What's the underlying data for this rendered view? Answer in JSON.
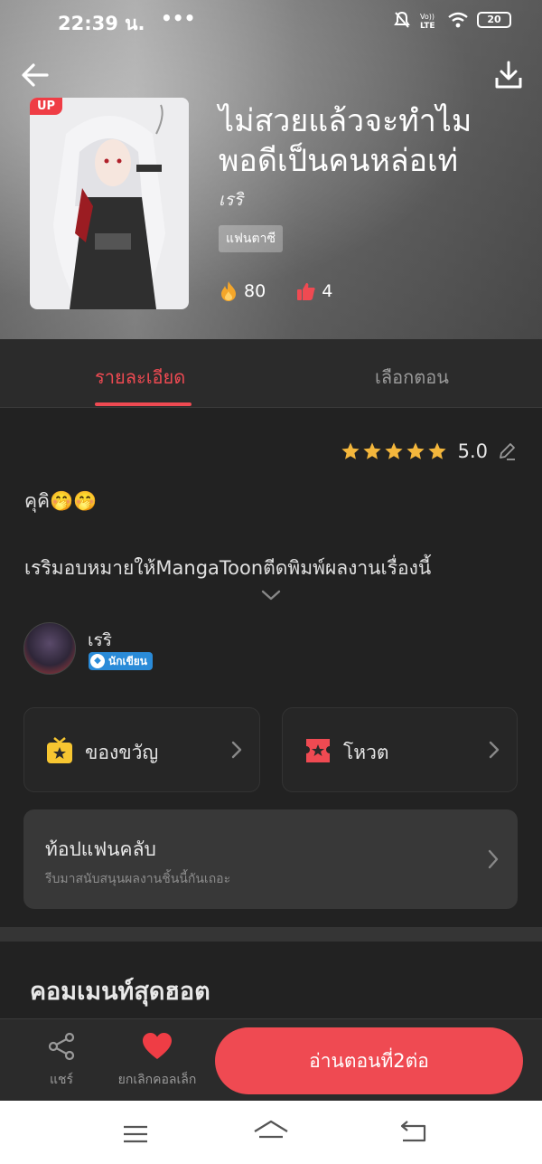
{
  "status_bar": {
    "time": "22:39 น.",
    "extra": "•••",
    "battery": "20"
  },
  "header": {
    "title_line1": "ไม่สวยแล้วจะทำไม",
    "title_line2": "พอดีเป็นคนหล่อเท่",
    "author": "เรริ",
    "genre": "แฟนตาซี",
    "cover_badge": "UP",
    "views": "80",
    "likes": "4"
  },
  "tabs": {
    "detail": "รายละเอียด",
    "episodes": "เลือกตอน"
  },
  "rating": {
    "value": "5.0",
    "stars": 5
  },
  "description": {
    "line1": "คุคิ🤭🤭",
    "line2": "เรริมอบหมายให้MangaToonตีดพิมพ์ผลงานเรื่องนี้"
  },
  "author_info": {
    "name": "เรริ",
    "badge": "นักเขียน"
  },
  "cards": {
    "gift_label": "ของขวัญ",
    "vote_label": "โหวต"
  },
  "fanclub": {
    "title": "ท้อปแฟนคลับ",
    "subtitle": "รีบมาสนับสนุนผลงานชิ้นนี้กันเถอะ"
  },
  "comments": {
    "title": "คอมเมนท์สุดฮอต"
  },
  "bottom_bar": {
    "share_label": "แชร์",
    "collect_label": "ยกเลิกคอลเล็ก",
    "read_label": "อ่านตอนที่2ต่อ"
  },
  "colors": {
    "accent": "#ef4a52",
    "background": "#222222",
    "card": "#262626",
    "badge_blue": "#2a8bd8",
    "star": "#f4b73c"
  },
  "icons": [
    "back-arrow-icon",
    "download-icon",
    "fire-icon",
    "thumbs-up-icon",
    "star-icon",
    "edit-icon",
    "chevron-down-icon",
    "gift-icon",
    "ticket-icon",
    "chevron-right-icon",
    "share-icon",
    "heart-icon",
    "menu-icon",
    "home-icon",
    "return-icon"
  ]
}
